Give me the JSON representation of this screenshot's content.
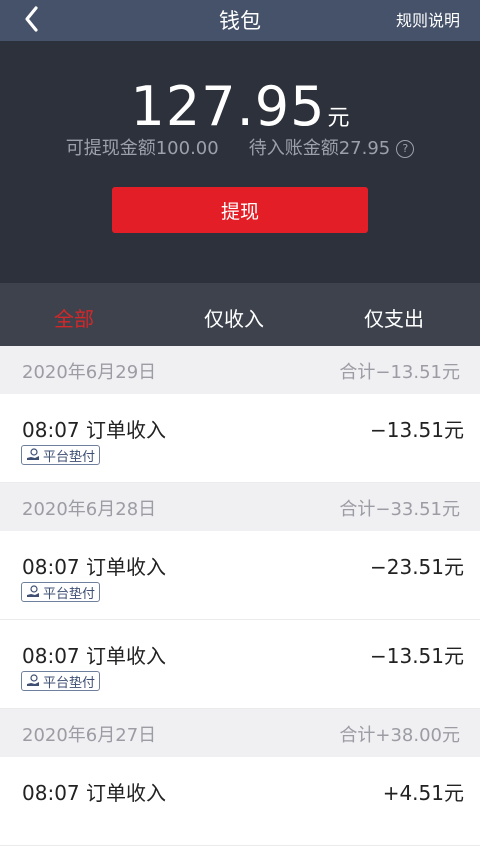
{
  "header": {
    "title": "钱包",
    "rules_label": "规则说明"
  },
  "summary": {
    "amount": "127.95",
    "unit": "元",
    "withdrawable": "可提现金额100.00",
    "pending": "待入账金额27.95",
    "help_symbol": "?",
    "withdraw_label": "提现"
  },
  "tabs": [
    {
      "label": "全部",
      "active": true
    },
    {
      "label": "仅收入",
      "active": false
    },
    {
      "label": "仅支出",
      "active": false
    }
  ],
  "groups": [
    {
      "date": "2020年6月29日",
      "sum": "合计−13.51元",
      "items": [
        {
          "time_label": "08:07  订单收入",
          "amount": "−13.51元",
          "badge": "平台垫付"
        }
      ]
    },
    {
      "date": "2020年6月28日",
      "sum": "合计−33.51元",
      "items": [
        {
          "time_label": "08:07  订单收入",
          "amount": "−23.51元",
          "badge": "平台垫付"
        },
        {
          "time_label": "08:07  订单收入",
          "amount": "−13.51元",
          "badge": "平台垫付"
        }
      ]
    },
    {
      "date": "2020年6月27日",
      "sum": "合计+38.00元",
      "items": [
        {
          "time_label": "08:07  订单收入",
          "amount": "+4.51元",
          "badge": ""
        }
      ]
    }
  ],
  "colors": {
    "accent": "#e41e26",
    "header_bg": "#45526a",
    "hero_bg": "#2d313b"
  },
  "icons": {
    "back": "chevron-left-icon",
    "help": "question-circle-icon",
    "badge": "hand-coin-icon"
  }
}
